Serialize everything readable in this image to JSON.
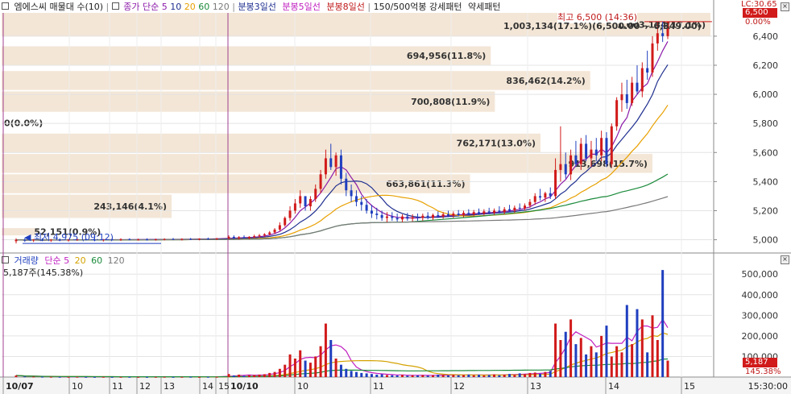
{
  "header": {
    "title": "엠에스씨 매물대 수(10)",
    "price_ma_label": "종가 단순",
    "price_ma_periods": [
      "5",
      "10",
      "20",
      "60",
      "120"
    ],
    "candle_lines": [
      "분봉3일선",
      "분봉5일선",
      "분봉8일선"
    ],
    "pattern_label": "150/500억봉 강세패턴",
    "weak_pattern_label": "약세패턴"
  },
  "volume_header": {
    "title": "거래량",
    "ma_label": "단순",
    "ma_periods": [
      "5",
      "20",
      "60",
      "120"
    ],
    "current": "5,187주(145.38%)"
  },
  "annotations": {
    "high": "최고 6,500 (14:36)",
    "low": "최저 4,975 (09:12)",
    "range": "1,003,134(17.1%)(6,500.00 ~ 6,349.00)",
    "top_right_label": "LC:30.65",
    "pct_tag": "0.00%"
  },
  "price_tags": {
    "current": "6,500",
    "volume_current": "5,187",
    "volume_pct": "145.38%"
  },
  "colors": {
    "up": "#d11a1a",
    "down": "#1f3fbf",
    "profile": "#f3e6d6",
    "ma5": "#8b1aa8",
    "ma10": "#1f2f8f",
    "ma20": "#e8a000",
    "ma60": "#1a8a3a",
    "ma120": "#7a7a7a",
    "vol_ma5": "#c020c0",
    "vol_ma20": "#d4a200",
    "vol_ma60": "#1a8a3a"
  },
  "chart_data": {
    "type": "bar",
    "title": "엠에스씨 매물대 수(10)",
    "price_axis": {
      "ticks": [
        "5,000",
        "5,200",
        "5,400",
        "5,600",
        "5,800",
        "6,000",
        "6,200",
        "6,400"
      ],
      "ylim": [
        4920,
        6560
      ]
    },
    "volume_axis": {
      "ticks": [
        "100,000",
        "200,000",
        "300,000",
        "400,000",
        "500,000"
      ],
      "ylim": [
        0,
        540000
      ]
    },
    "time_axis": {
      "ticks": [
        {
          "label": "10/07",
          "major": true
        },
        {
          "label": "10",
          "major": false
        },
        {
          "label": "11",
          "major": false
        },
        {
          "label": "12",
          "major": false
        },
        {
          "label": "13",
          "major": false
        },
        {
          "label": "14",
          "major": false
        },
        {
          "label": "15",
          "major": false
        },
        {
          "label": "10/10",
          "major": true
        },
        {
          "label": "10",
          "major": false
        },
        {
          "label": "11",
          "major": false
        },
        {
          "label": "12",
          "major": false
        },
        {
          "label": "13",
          "major": false
        },
        {
          "label": "14",
          "major": false
        },
        {
          "label": "15",
          "major": false
        },
        {
          "label": "15:30:00",
          "major": false
        }
      ]
    },
    "volume_profile": [
      {
        "price_low": 6400,
        "price_high": 6560,
        "label": "1,003,134(17.1%)"
      },
      {
        "price_low": 6200,
        "price_high": 6330,
        "label": "694,956(11.8%)"
      },
      {
        "price_low": 6030,
        "price_high": 6160,
        "label": "836,462(14.2%)"
      },
      {
        "price_low": 5880,
        "price_high": 6020,
        "label": "700,808(11.9%)"
      },
      {
        "price_low": 5740,
        "price_high": 5870,
        "label": "0(0.0%)"
      },
      {
        "price_low": 5600,
        "price_high": 5730,
        "label": "762,171(13.0%)"
      },
      {
        "price_low": 5460,
        "price_high": 5590,
        "label": "913,698(15.7%)"
      },
      {
        "price_low": 5320,
        "price_high": 5450,
        "label": "663,861(11.3%)"
      },
      {
        "price_low": 5150,
        "price_high": 5310,
        "label": "243,146(4.1%)"
      },
      {
        "price_low": 5030,
        "price_high": 5080,
        "label": "52,151(0.9%)"
      }
    ],
    "series": [
      {
        "name": "price",
        "type": "candlestick",
        "ohlc": [
          [
            4990,
            5010,
            4975,
            5000
          ],
          [
            5000,
            5010,
            4985,
            4995
          ],
          [
            4995,
            5005,
            4985,
            5000
          ],
          [
            5000,
            5010,
            4990,
            4995
          ],
          [
            4995,
            5005,
            4985,
            5000
          ],
          [
            5000,
            5008,
            4990,
            4998
          ],
          [
            4998,
            5005,
            4988,
            5000
          ],
          [
            5000,
            5010,
            4992,
            5003
          ],
          [
            5003,
            5010,
            4995,
            5000
          ],
          [
            5000,
            5008,
            4990,
            4996
          ],
          [
            4996,
            5005,
            4988,
            5002
          ],
          [
            5002,
            5010,
            4995,
            5000
          ],
          [
            5000,
            5010,
            4992,
            5004
          ],
          [
            5004,
            5010,
            4996,
            5000
          ],
          [
            5000,
            5008,
            4994,
            5002
          ],
          [
            5002,
            5010,
            4995,
            5000
          ],
          [
            5000,
            5008,
            4994,
            5003
          ],
          [
            5003,
            5010,
            4996,
            5005
          ],
          [
            5005,
            5012,
            4998,
            5002
          ],
          [
            5002,
            5010,
            4995,
            5006
          ],
          [
            5006,
            5012,
            4998,
            5003
          ],
          [
            5003,
            5010,
            4996,
            5008
          ],
          [
            5008,
            5015,
            5000,
            5005
          ],
          [
            5005,
            5012,
            4998,
            5010
          ],
          [
            5010,
            5030,
            5000,
            5020
          ],
          [
            5020,
            5030,
            5005,
            5010
          ],
          [
            5010,
            5025,
            5000,
            5018
          ],
          [
            5018,
            5030,
            5008,
            5012
          ],
          [
            5012,
            5025,
            5002,
            5020
          ],
          [
            5020,
            5035,
            5010,
            5025
          ],
          [
            5025,
            5040,
            5015,
            5030
          ],
          [
            5030,
            5045,
            5020,
            5038
          ],
          [
            5038,
            5060,
            5030,
            5050
          ],
          [
            5050,
            5080,
            5040,
            5070
          ],
          [
            5070,
            5120,
            5060,
            5100
          ],
          [
            5100,
            5160,
            5090,
            5150
          ],
          [
            5150,
            5230,
            5130,
            5200
          ],
          [
            5200,
            5280,
            5180,
            5250
          ],
          [
            5250,
            5340,
            5220,
            5300
          ],
          [
            5300,
            5290,
            5200,
            5230
          ],
          [
            5230,
            5300,
            5200,
            5280
          ],
          [
            5280,
            5380,
            5260,
            5350
          ],
          [
            5350,
            5480,
            5320,
            5450
          ],
          [
            5450,
            5620,
            5420,
            5560
          ],
          [
            5560,
            5660,
            5480,
            5500
          ],
          [
            5500,
            5600,
            5440,
            5580
          ],
          [
            5580,
            5620,
            5380,
            5420
          ],
          [
            5420,
            5460,
            5300,
            5340
          ],
          [
            5340,
            5380,
            5260,
            5300
          ],
          [
            5300,
            5340,
            5230,
            5260
          ],
          [
            5260,
            5300,
            5200,
            5240
          ],
          [
            5240,
            5280,
            5180,
            5200
          ],
          [
            5200,
            5240,
            5150,
            5180
          ],
          [
            5180,
            5220,
            5140,
            5170
          ],
          [
            5170,
            5200,
            5130,
            5150
          ],
          [
            5150,
            5190,
            5120,
            5160
          ],
          [
            5160,
            5190,
            5130,
            5150
          ],
          [
            5150,
            5180,
            5125,
            5140
          ],
          [
            5140,
            5175,
            5120,
            5160
          ],
          [
            5160,
            5185,
            5130,
            5145
          ],
          [
            5145,
            5175,
            5125,
            5155
          ],
          [
            5155,
            5180,
            5130,
            5150
          ],
          [
            5150,
            5180,
            5130,
            5165
          ],
          [
            5165,
            5190,
            5140,
            5150
          ],
          [
            5150,
            5180,
            5135,
            5170
          ],
          [
            5170,
            5195,
            5150,
            5160
          ],
          [
            5160,
            5190,
            5145,
            5175
          ],
          [
            5175,
            5200,
            5155,
            5165
          ],
          [
            5165,
            5195,
            5150,
            5180
          ],
          [
            5180,
            5205,
            5160,
            5170
          ],
          [
            5170,
            5200,
            5155,
            5185
          ],
          [
            5185,
            5210,
            5165,
            5175
          ],
          [
            5175,
            5205,
            5160,
            5190
          ],
          [
            5190,
            5215,
            5170,
            5180
          ],
          [
            5180,
            5210,
            5165,
            5195
          ],
          [
            5195,
            5220,
            5175,
            5185
          ],
          [
            5185,
            5215,
            5170,
            5200
          ],
          [
            5200,
            5230,
            5180,
            5190
          ],
          [
            5190,
            5225,
            5175,
            5210
          ],
          [
            5210,
            5240,
            5190,
            5200
          ],
          [
            5200,
            5235,
            5185,
            5220
          ],
          [
            5220,
            5250,
            5200,
            5215
          ],
          [
            5215,
            5250,
            5200,
            5235
          ],
          [
            5235,
            5280,
            5220,
            5260
          ],
          [
            5260,
            5320,
            5240,
            5300
          ],
          [
            5300,
            5350,
            5270,
            5290
          ],
          [
            5290,
            5330,
            5260,
            5320
          ],
          [
            5320,
            5360,
            5280,
            5300
          ],
          [
            5300,
            5560,
            5280,
            5480
          ],
          [
            5480,
            5780,
            5400,
            5520
          ],
          [
            5520,
            5600,
            5420,
            5450
          ],
          [
            5450,
            5620,
            5410,
            5580
          ],
          [
            5580,
            5680,
            5500,
            5520
          ],
          [
            5520,
            5700,
            5480,
            5660
          ],
          [
            5660,
            5720,
            5540,
            5560
          ],
          [
            5560,
            5680,
            5500,
            5620
          ],
          [
            5620,
            5700,
            5540,
            5580
          ],
          [
            5580,
            5750,
            5540,
            5700
          ],
          [
            5700,
            5740,
            5500,
            5520
          ],
          [
            5520,
            5800,
            5500,
            5780
          ],
          [
            5780,
            5980,
            5750,
            5960
          ],
          [
            5960,
            6080,
            5880,
            6000
          ],
          [
            6000,
            6100,
            5900,
            5940
          ],
          [
            5940,
            6120,
            5920,
            6080
          ],
          [
            6080,
            6200,
            6000,
            6020
          ],
          [
            6020,
            6220,
            5980,
            6180
          ],
          [
            6180,
            6300,
            6100,
            6150
          ],
          [
            6150,
            6400,
            6120,
            6350
          ],
          [
            6350,
            6500,
            6300,
            6420
          ],
          [
            6420,
            6500,
            6360,
            6400
          ],
          [
            6400,
            6500,
            6380,
            6500
          ]
        ]
      },
      {
        "name": "volume",
        "type": "bar",
        "values": [
          8000,
          3000,
          2000,
          1500,
          1200,
          1000,
          900,
          1200,
          800,
          700,
          1000,
          600,
          800,
          900,
          700,
          600,
          800,
          1000,
          700,
          900,
          1100,
          800,
          1000,
          1200,
          15000,
          8000,
          12000,
          6000,
          9000,
          10000,
          12000,
          14000,
          20000,
          25000,
          40000,
          60000,
          110000,
          90000,
          130000,
          80000,
          70000,
          100000,
          150000,
          260000,
          180000,
          90000,
          60000,
          40000,
          30000,
          25000,
          20000,
          18000,
          15000,
          12000,
          14000,
          10000,
          9000,
          8000,
          11000,
          7000,
          9000,
          8000,
          10000,
          7000,
          9000,
          12000,
          10000,
          8000,
          11000,
          9000,
          10000,
          12000,
          9000,
          11000,
          8000,
          10000,
          13000,
          9000,
          12000,
          15000,
          11000,
          18000,
          14000,
          20000,
          22000,
          16000,
          25000,
          30000,
          260000,
          180000,
          220000,
          280000,
          160000,
          190000,
          110000,
          150000,
          120000,
          200000,
          250000,
          100000,
          150000,
          120000,
          350000,
          160000,
          330000,
          280000,
          120000,
          300000,
          180000,
          520000,
          80000,
          30000,
          5187
        ]
      }
    ]
  }
}
